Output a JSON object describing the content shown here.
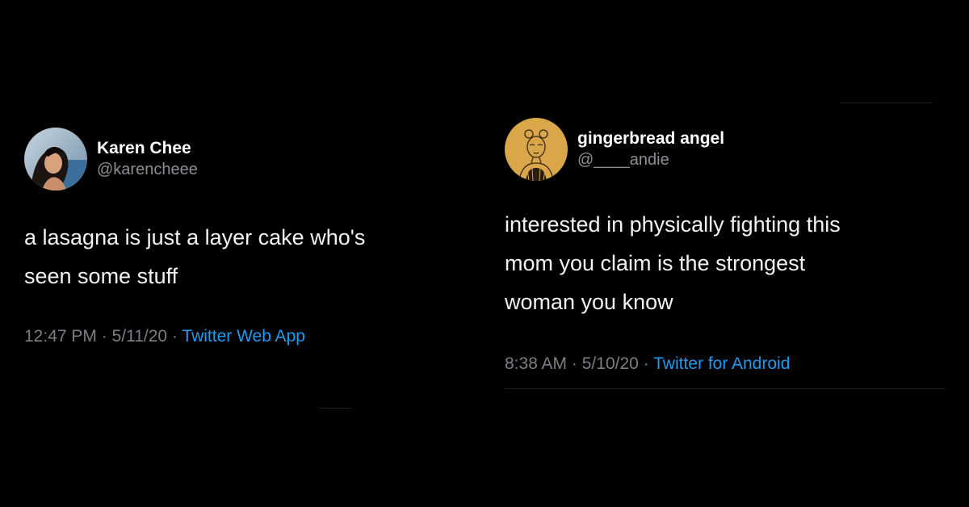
{
  "tweets": [
    {
      "display_name": "Karen Chee",
      "handle": "@karencheee",
      "text": "a lasagna is just a layer cake who's\nseen some stuff",
      "time": "12:47 PM",
      "date": "5/11/20",
      "separator": "·",
      "source": "Twitter Web App"
    },
    {
      "display_name": "gingerbread angel",
      "handle": "@____andie",
      "text": "interested in physically fighting this\nmom you claim is the strongest\nwoman you know",
      "time": "8:38 AM",
      "date": "5/10/20",
      "separator": "·",
      "source": "Twitter for Android"
    }
  ],
  "colors": {
    "background": "#000000",
    "name": "#ffffff",
    "handle": "#8b8f93",
    "meta": "#7b7f84",
    "source_link": "#1d9bf0",
    "avatar_right_bg": "#d9a64a"
  }
}
